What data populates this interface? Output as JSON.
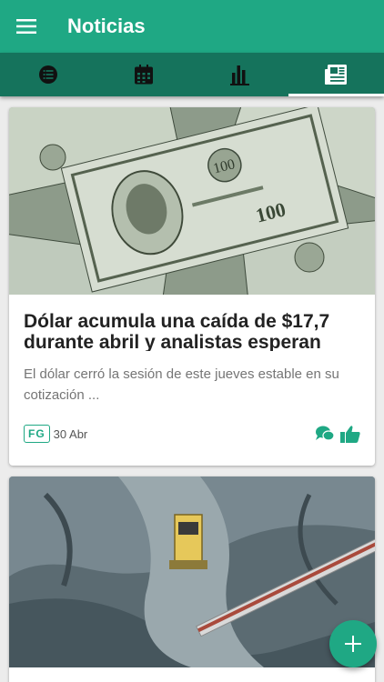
{
  "header": {
    "title": "Noticias",
    "menu_icon": "menu-icon"
  },
  "tabs": [
    {
      "icon": "list-icon",
      "active": false
    },
    {
      "icon": "calendar-icon",
      "active": false
    },
    {
      "icon": "bar-chart-icon",
      "active": false
    },
    {
      "icon": "newspaper-icon",
      "active": true
    }
  ],
  "articles": [
    {
      "image": "dollar-bills-photo",
      "title": "Dólar acumula una caída de $17,7 durante abril y analistas esperan",
      "excerpt": "El dólar cerró la sesión de este jueves estable en su cotización  ...",
      "source": "FG",
      "date": "30 Abr"
    },
    {
      "image": "mining-excavator-aerial-photo"
    }
  ],
  "colors": {
    "primary": "#1fa884",
    "primary_dark": "#15735c",
    "background": "#ececec"
  },
  "fab": {
    "icon": "plus-icon"
  }
}
